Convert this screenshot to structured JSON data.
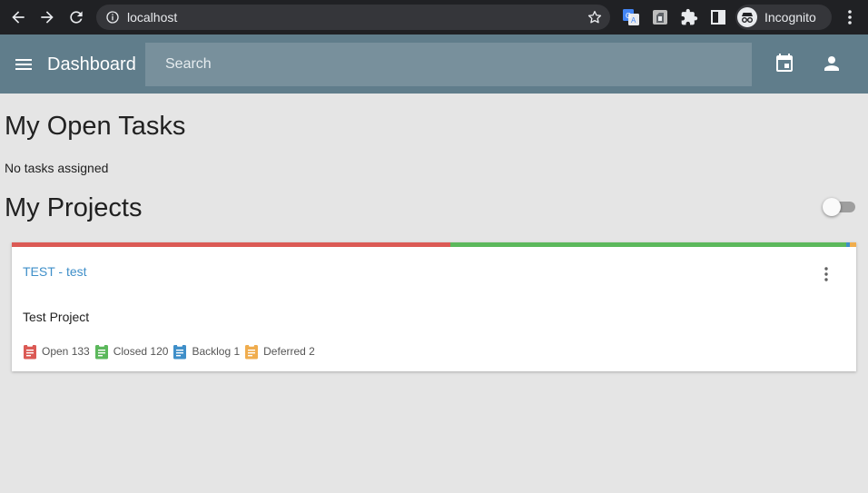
{
  "browser": {
    "url": "localhost",
    "profile_label": "Incognito"
  },
  "toolbar": {
    "title": "Dashboard",
    "search_placeholder": "Search"
  },
  "tasks": {
    "heading": "My Open Tasks",
    "empty_text": "No tasks assigned"
  },
  "projects": {
    "heading": "My Projects",
    "toggle_on": false,
    "items": [
      {
        "title": "TEST - test",
        "description": "Test Project",
        "stats": [
          {
            "label": "Open 133",
            "color": "#db5a55"
          },
          {
            "label": "Closed 120",
            "color": "#5cb85c"
          },
          {
            "label": "Backlog 1",
            "color": "#3f8fc9"
          },
          {
            "label": "Deferred 2",
            "color": "#f0ad4e"
          }
        ],
        "progress": [
          {
            "count": 133,
            "color": "#db5a55"
          },
          {
            "count": 120,
            "color": "#5cb85c"
          },
          {
            "count": 1,
            "color": "#3f8fc9"
          },
          {
            "count": 2,
            "color": "#f0ad4e"
          }
        ]
      }
    ]
  }
}
